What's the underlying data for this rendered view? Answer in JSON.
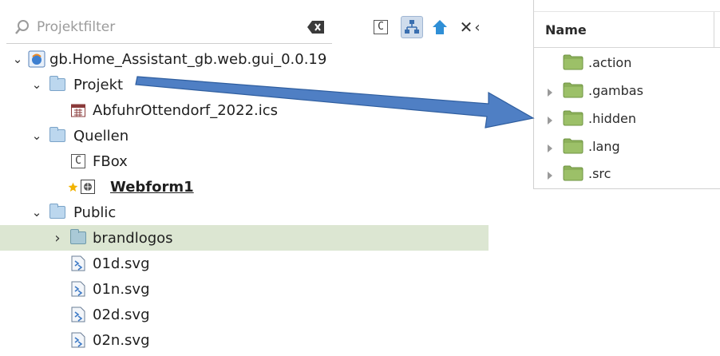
{
  "project": {
    "filter_placeholder": "Projektfilter",
    "toolbar": {
      "close_glyph": "✕",
      "more_glyph": "‹"
    },
    "rows": [
      {
        "label": "gb.Home_Assistant_gb.web.gui_0.0.19",
        "chevron": "⌄",
        "icon": "project-icon",
        "indent": 0
      },
      {
        "label": "Projekt",
        "chevron": "⌄",
        "icon": "folder-icon",
        "indent": 1
      },
      {
        "label": "AbfuhrOttendorf_2022.ics",
        "chevron": "",
        "icon": "calendar-icon",
        "indent": 2
      },
      {
        "label": "Quellen",
        "chevron": "⌄",
        "icon": "folder-icon",
        "indent": 1
      },
      {
        "label": "FBox",
        "chevron": "",
        "icon": "class-icon",
        "indent": 2
      },
      {
        "label": "Webform1",
        "chevron": "",
        "icon": "webform-icon",
        "indent": 2,
        "startup": true
      },
      {
        "label": "Public",
        "chevron": "⌄",
        "icon": "folder-icon",
        "indent": 1
      },
      {
        "label": "brandlogos",
        "chevron": "›",
        "icon": "folder-icon",
        "indent": 2,
        "selected": true
      },
      {
        "label": "01d.svg",
        "chevron": "",
        "icon": "svg-file-icon",
        "indent": 2
      },
      {
        "label": "01n.svg",
        "chevron": "",
        "icon": "svg-file-icon",
        "indent": 2
      },
      {
        "label": "02d.svg",
        "chevron": "",
        "icon": "svg-file-icon",
        "indent": 2
      },
      {
        "label": "02n.svg",
        "chevron": "",
        "icon": "svg-file-icon",
        "indent": 2
      }
    ],
    "class_icon_letter": "C",
    "selected_row_color": "#dce6d2"
  },
  "file_manager": {
    "column_header": "Name",
    "items": [
      {
        "name": ".action",
        "expandable": false
      },
      {
        "name": ".gambas",
        "expandable": true
      },
      {
        "name": ".hidden",
        "expandable": true
      },
      {
        "name": ".lang",
        "expandable": true
      },
      {
        "name": ".src",
        "expandable": true
      }
    ],
    "folder_color": "#8cb05a"
  },
  "arrow_color": "#4f7fc4"
}
